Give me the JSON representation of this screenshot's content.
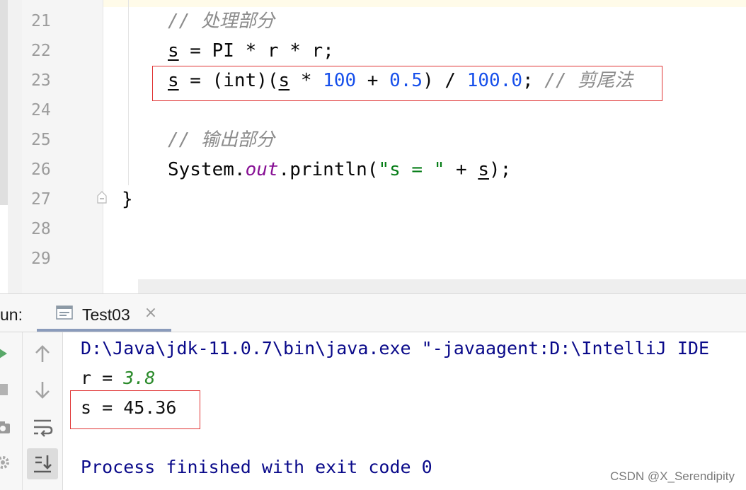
{
  "editor": {
    "line_numbers": [
      "21",
      "22",
      "23",
      "24",
      "25",
      "26",
      "27",
      "28",
      "29"
    ],
    "lines": {
      "l21_comment_slashes": "//",
      "l21_comment_text": "处理部分",
      "l22_var": "s",
      "l22_rest": " = PI * r * r;",
      "l23_var1": "s",
      "l23_a": " = (int)(",
      "l23_var2": "s",
      "l23_b": " * ",
      "l23_n1": "100",
      "l23_c": " + ",
      "l23_n2": "0.5",
      "l23_d": ") / ",
      "l23_n3": "100.0",
      "l23_e": "; ",
      "l23_comment_slashes": "//",
      "l23_comment_text": "剪尾法",
      "l25_comment_slashes": "//",
      "l25_comment_text": "输出部分",
      "l26_a": "System.",
      "l26_field": "out",
      "l26_b": ".println(",
      "l26_str": "\"s = \"",
      "l26_c": " + ",
      "l26_var": "s",
      "l26_d": ");",
      "l27_brace": "}"
    }
  },
  "run": {
    "label": "un:",
    "tab_label": "Test03",
    "tab_close": "×",
    "output": {
      "cmd": "D:\\Java\\jdk-11.0.7\\bin\\java.exe \"-javaagent:D:\\IntelliJ IDE",
      "r_prefix": "r = ",
      "r_value": "3.8",
      "s_line": "s = 45.36",
      "process": "Process finished with exit code 0"
    }
  },
  "watermark": "CSDN @X_Serendipity",
  "icons": {
    "run": "play-icon",
    "stop": "stop-icon",
    "up": "arrow-up-icon",
    "down": "arrow-down-icon",
    "wrap": "soft-wrap-icon",
    "scroll_end": "scroll-to-end-icon"
  },
  "colors": {
    "highlight_box": "#e03434",
    "number": "#1750eb",
    "string": "#067d17",
    "comment": "#8c8c8c",
    "field": "#871094",
    "console_text": "#0a0a8a"
  }
}
